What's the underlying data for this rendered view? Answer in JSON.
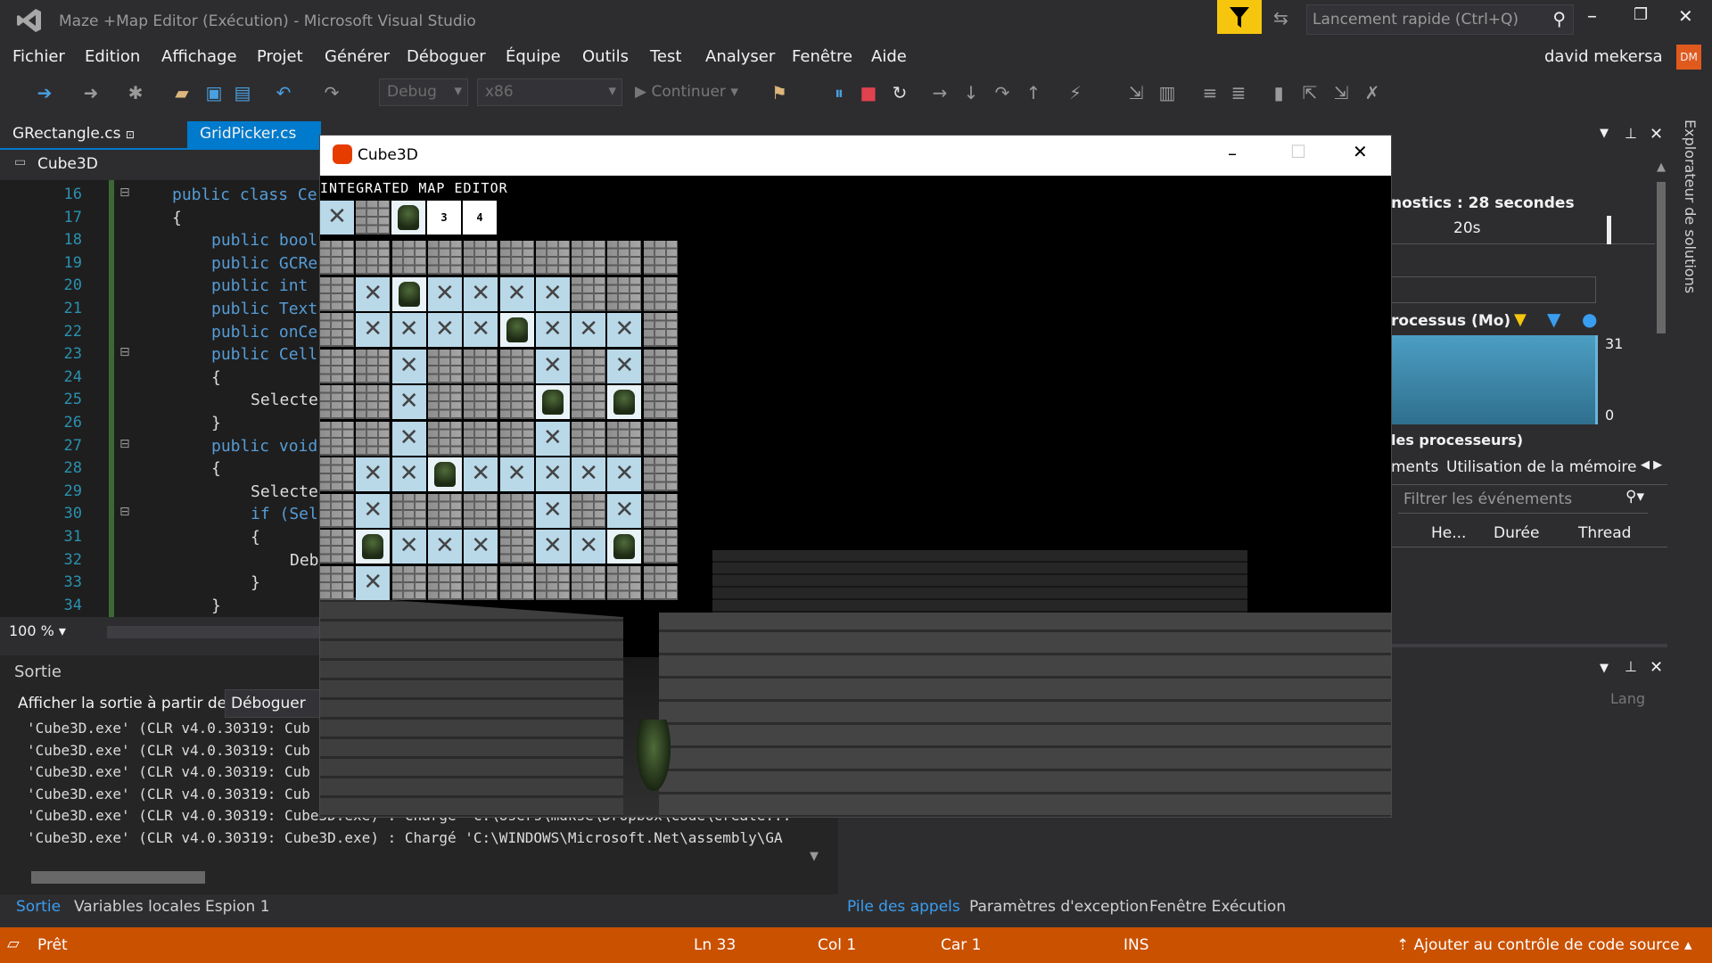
{
  "titlebar": {
    "window_title": "Maze +Map Editor (Exécution) - Microsoft Visual Studio",
    "quick_launch_placeholder": "Lancement rapide (Ctrl+Q)",
    "user_name": "david mekersa",
    "user_initials": "DM"
  },
  "menu": [
    "Fichier",
    "Edition",
    "Affichage",
    "Projet",
    "Générer",
    "Déboguer",
    "Équipe",
    "Outils",
    "Test",
    "Analyser",
    "Fenêtre",
    "Aide"
  ],
  "toolbar": {
    "config": "Debug",
    "platform": "x86",
    "continue_label": "Continuer"
  },
  "editor": {
    "tabs": [
      "GRectangle.cs",
      "GridPicker.cs"
    ],
    "project": "Cube3D",
    "zoom": "100 %",
    "lines": [
      {
        "n": "16",
        "code": "public class Ce"
      },
      {
        "n": "17",
        "code": "{"
      },
      {
        "n": "18",
        "code": "public bool"
      },
      {
        "n": "19",
        "code": "public GCRe"
      },
      {
        "n": "20",
        "code": "public int"
      },
      {
        "n": "21",
        "code": "public Text"
      },
      {
        "n": "22",
        "code": "public onCe"
      },
      {
        "n": "23",
        "code": "public Cell"
      },
      {
        "n": "24",
        "code": "{"
      },
      {
        "n": "25",
        "code": "Selecte"
      },
      {
        "n": "26",
        "code": "}"
      },
      {
        "n": "27",
        "code": "public void"
      },
      {
        "n": "28",
        "code": "{"
      },
      {
        "n": "29",
        "code": "Selecte"
      },
      {
        "n": "30",
        "code": "if (Sel"
      },
      {
        "n": "31",
        "code": "{"
      },
      {
        "n": "32",
        "code": "Deb"
      },
      {
        "n": "33",
        "code": "}"
      },
      {
        "n": "34",
        "code": "}"
      }
    ]
  },
  "output": {
    "title": "Sortie",
    "source_label": "Afficher la sortie à partir de :",
    "source_value": "Déboguer",
    "lines": [
      "'Cube3D.exe' (CLR v4.0.30319: Cub",
      "'Cube3D.exe' (CLR v4.0.30319: Cub",
      "'Cube3D.exe' (CLR v4.0.30319: Cub",
      "'Cube3D.exe' (CLR v4.0.30319: Cub",
      "'Cube3D.exe' (CLR v4.0.30319: Cube3D.exe) : Chargé 'C:\\Users\\mdkse\\Dropbox\\Code\\Create...",
      "'Cube3D.exe' (CLR v4.0.30319: Cube3D.exe) : Chargé 'C:\\WINDOWS\\Microsoft.Net\\assembly\\GA"
    ],
    "tabs": [
      "Sortie",
      "Variables locales",
      "Espion 1"
    ]
  },
  "right_tabs": [
    "Pile des appels",
    "Paramètres d'exception",
    "Fenêtre Exécution"
  ],
  "diagnostics": {
    "session": "nostics : 28 secondes",
    "time_tick": "20s",
    "memory_label": "rocessus (Mo)",
    "mem_max": "31",
    "mem_min": "0",
    "cpu_label": "les processeurs)",
    "tab_events": "ments",
    "tab_memory": "Utilisation de la mémoire",
    "filter_placeholder": "Filtrer les événements",
    "col_heure": "He...",
    "col_duree": "Durée",
    "col_thread": "Thread",
    "lang_label": "Lang",
    "solution_explorer": "Explorateur de solutions"
  },
  "game": {
    "window_title": "Cube3D",
    "editor_title": "INTEGRATED MAP EDITOR",
    "palette": [
      "empty",
      "brick",
      "enemy",
      "3",
      "4"
    ],
    "grid": [
      "BBBBBBBBBB",
      "BEMEEEEBBB",
      "BEEEEMEEEB",
      "BBEBBBEBEB",
      "BBEBBBMBMB",
      "BBEBBBEBBB",
      "BEEMEEEEEB",
      "BEBBBBEBEB",
      "BMEEEBEEMB",
      "BEBBBBBBBB"
    ]
  },
  "status": {
    "ready": "Prêt",
    "ln": "Ln 33",
    "col": "Col 1",
    "car": "Car 1",
    "ins": "INS",
    "source_control": "Ajouter au contrôle de code source"
  }
}
